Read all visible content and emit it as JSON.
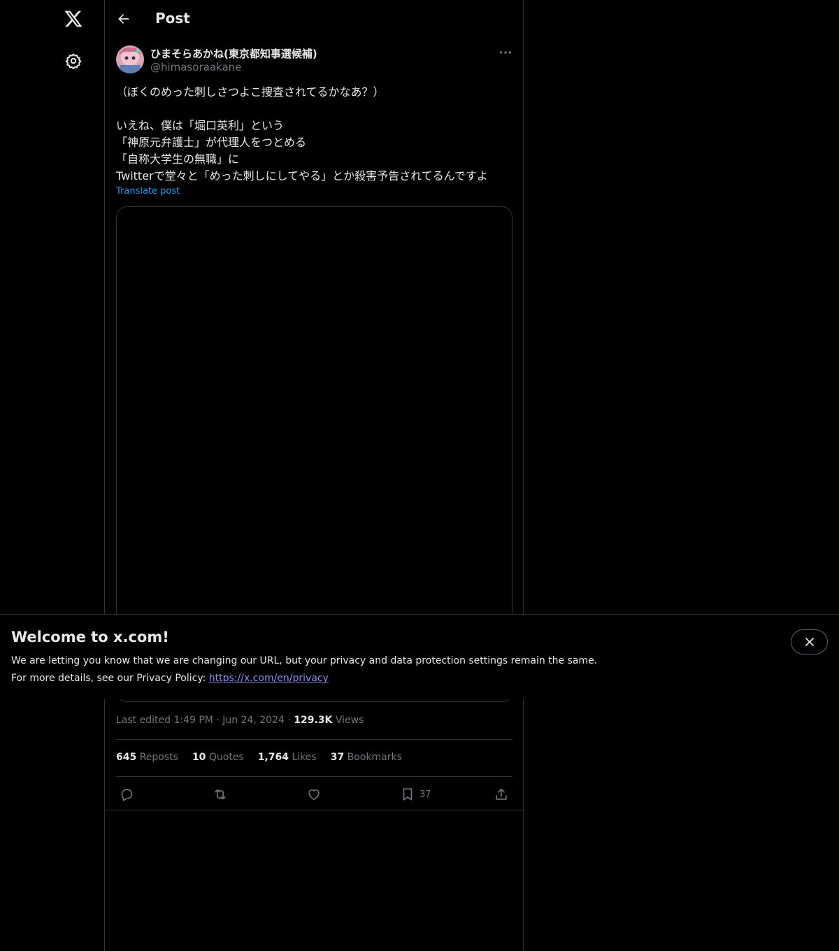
{
  "nav": {
    "logo_icon": "x-logo-icon",
    "settings_icon": "gear-icon"
  },
  "header": {
    "title": "Post",
    "back_icon": "arrow-left-icon"
  },
  "post": {
    "author_name": "ひまそらあかね(東京都知事選候補)",
    "author_handle": "@himasoraakane",
    "text_lines": [
      "（ぼくのめった刺しさつよこ捜査されてるかなあ？）",
      "",
      "いえね、僕は「堀口英利」という",
      "「神原元弁護士」が代理人をつとめる",
      "「自称大学生の無職」に",
      "Twitterで堂々と「めった刺しにしてやる」とか殺害予告されてるんですよ"
    ],
    "translate_label": "Translate post",
    "meta": {
      "edited_label": "Last edited 1:49 PM",
      "date": "Jun 24, 2024",
      "views_count": "129.3K",
      "views_label": "Views"
    },
    "stats": {
      "reposts_count": "645",
      "reposts_label": "Reposts",
      "quotes_count": "10",
      "quotes_label": "Quotes",
      "likes_count": "1,764",
      "likes_label": "Likes",
      "bookmarks_count": "37",
      "bookmarks_label": "Bookmarks"
    },
    "actions": {
      "bookmark_count": "37"
    }
  },
  "banner": {
    "title": "Welcome to x.com!",
    "line1": "We are letting you know that we are changing our URL, but your privacy and data protection settings remain the same.",
    "line2_prefix": "For more details, see our Privacy Policy: ",
    "link_text": "https://x.com/en/privacy"
  },
  "colors": {
    "background": "#000000",
    "text": "#e7e9ea",
    "muted": "#71767b",
    "link": "#1d9bf0",
    "border": "#2f3336"
  }
}
